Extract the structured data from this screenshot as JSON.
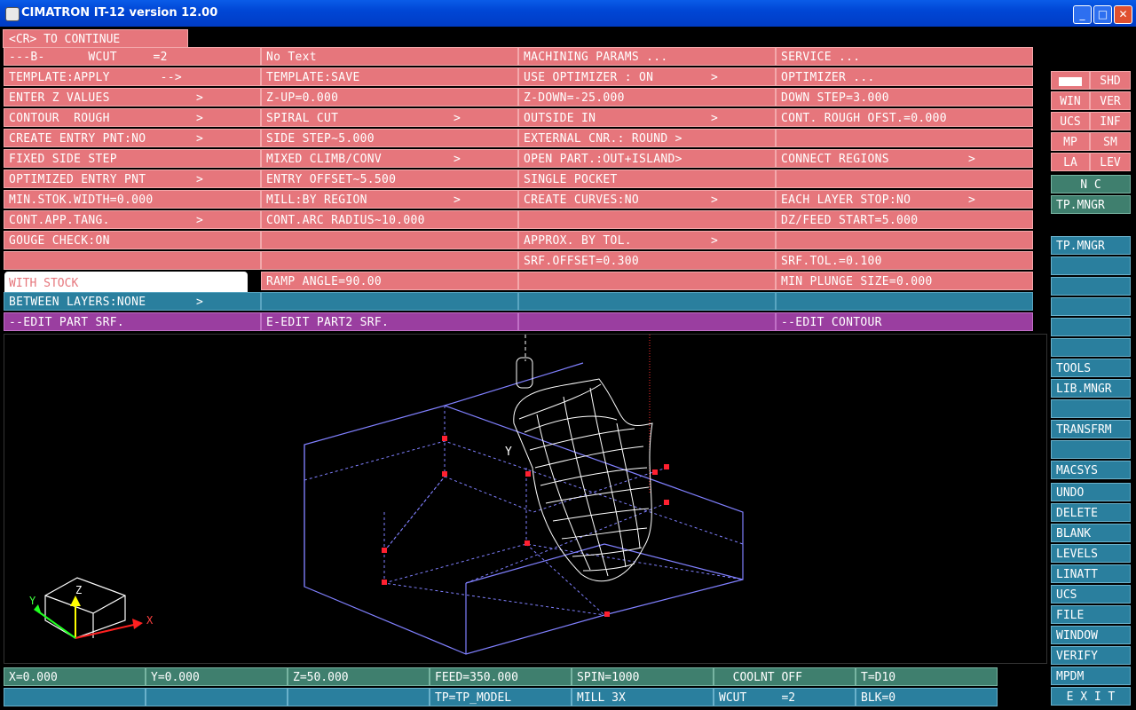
{
  "window": {
    "title": "CIMATRON IT-12 version 12.00",
    "minimize": "_",
    "maximize": "□",
    "close": "✕"
  },
  "prompt": "<CR> TO CONTINUE",
  "menu": {
    "col1": [
      "---B-      WCUT     =2",
      "TEMPLATE:APPLY       -->",
      "ENTER Z VALUES",
      "CONTOUR  ROUGH",
      "CREATE ENTRY PNT:NO",
      "FIXED SIDE STEP",
      "OPTIMIZED ENTRY PNT",
      "MIN.STOK.WIDTH=0.000",
      "CONT.APP.TANG.",
      "GOUGE CHECK:ON",
      "",
      "WITH STOCK"
    ],
    "col2": [
      "No Text",
      "TEMPLATE:SAVE",
      "Z-UP=0.000",
      "SPIRAL CUT",
      "SIDE STEP~5.000",
      "MIXED CLIMB/CONV",
      "ENTRY OFFSET~5.500",
      "MILL:BY REGION",
      "CONT.ARC RADIUS~10.000",
      "",
      "",
      "RAMP ANGLE=90.00"
    ],
    "col3": [
      "MACHINING PARAMS ...",
      "USE OPTIMIZER : ON",
      "Z-DOWN=-25.000",
      "OUTSIDE IN",
      "EXTERNAL CNR.: ROUND >",
      "OPEN PART.:OUT+ISLAND>",
      "SINGLE POCKET",
      "CREATE CURVES:NO",
      "",
      "APPROX. BY TOL.",
      "SRF.OFFSET=0.300",
      ""
    ],
    "col4": [
      "SERVICE ...",
      "OPTIMIZER ...",
      "DOWN STEP=3.000",
      "CONT. ROUGH OFST.=0.000",
      "",
      "CONNECT REGIONS",
      "",
      "EACH LAYER STOP:NO",
      "DZ/FEED START=5.000",
      "",
      "SRF.TOL.=0.100",
      "MIN PLUNGE SIZE=0.000"
    ],
    "between_layers": "BETWEEN LAYERS:NONE",
    "edit": [
      "--EDIT PART SRF.",
      "E-EDIT PART2 SRF.",
      "",
      "--EDIT CONTOUR"
    ]
  },
  "side_grid": [
    "",
    "SHD",
    "WIN",
    "VER",
    "UCS",
    "INF",
    "MP",
    "SM",
    "LA",
    "LEV"
  ],
  "side": [
    "N C",
    "TP.MNGR",
    "TP.MNGR",
    "",
    "",
    "",
    "",
    "",
    "TOOLS",
    "LIB.MNGR",
    "",
    "TRANSFRM",
    "",
    "MACSYS",
    "UNDO",
    "DELETE",
    "BLANK",
    "LEVELS",
    "LINATT",
    "UCS",
    "FILE",
    "WINDOW",
    "VERIFY",
    "MPDM",
    "E X I T"
  ],
  "status_row1": [
    "X=0.000",
    "Y=0.000",
    "Z=50.000",
    "FEED=350.000",
    "SPIN=1000",
    "  COOLNT OFF",
    "T=D10"
  ],
  "status_row2": [
    "",
    "",
    "",
    "TP=TP_MODEL",
    "MILL 3X",
    "WCUT     =2",
    "BLK=0"
  ],
  "axes": {
    "x": "X",
    "y": "Y",
    "z": "Z"
  },
  "viewport_label": "Y"
}
